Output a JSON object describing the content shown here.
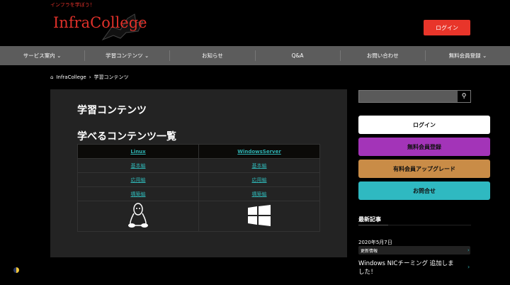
{
  "header": {
    "tagline": "インフラを学ぼう！",
    "logo": "InfraCollege",
    "login": "ログイン"
  },
  "nav": [
    {
      "label": "サービス案内 ⌄"
    },
    {
      "label": "学習コンテンツ ⌄"
    },
    {
      "label": "お知らせ"
    },
    {
      "label": "Q&A"
    },
    {
      "label": "お問い合わせ"
    },
    {
      "label": "無料会員登録 ⌄"
    }
  ],
  "breadcrumb": {
    "home": "InfraCollege",
    "sep": "›",
    "current": "学習コンテンツ"
  },
  "main": {
    "title": "学習コンテンツ",
    "subtitle": "学べるコンテンツ一覧",
    "table": {
      "headers": [
        "Linux",
        "WindowsServer"
      ],
      "rows": [
        [
          "基本編",
          "基本編"
        ],
        [
          "応用編",
          "応用編"
        ],
        [
          "構築編",
          "構築編"
        ]
      ]
    }
  },
  "sidebar": {
    "buttons": [
      {
        "label": "ログイン",
        "color": "#ffffff"
      },
      {
        "label": "無料会員登録",
        "color": "#a334b8"
      },
      {
        "label": "有料会員アップグレード",
        "color": "#c98c47"
      },
      {
        "label": "お問合せ",
        "color": "#2fb9c1"
      }
    ],
    "recent": {
      "heading": "最新記事",
      "date": "2020年5月7日",
      "tag": "更新情報",
      "title": "Windows NICチーミング 追加しました！"
    }
  }
}
